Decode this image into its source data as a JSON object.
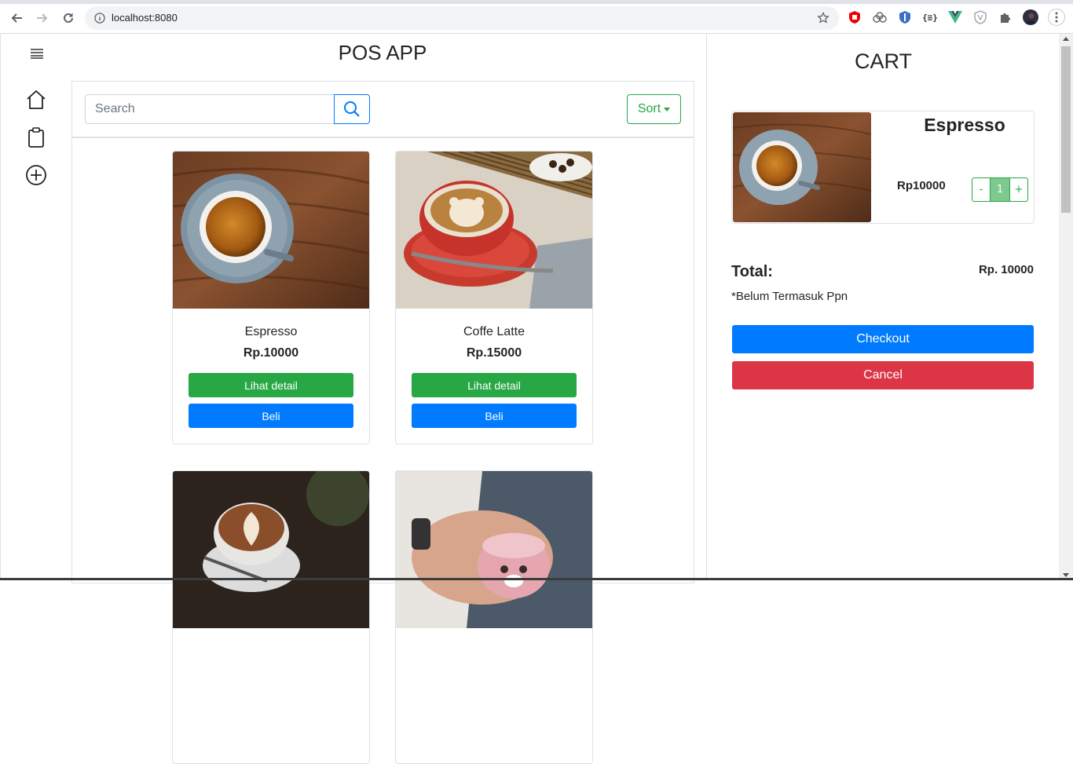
{
  "browser": {
    "url": "localhost:8080",
    "extensions": [
      "ublock-icon",
      "cloud-icon",
      "shield-icon",
      "json-icon",
      "vue-devtools-icon",
      "shield-outline-icon",
      "puzzle-icon",
      "profile-avatar",
      "menu-icon"
    ]
  },
  "sidebar": {
    "items": [
      {
        "icon": "home-icon"
      },
      {
        "icon": "clipboard-icon"
      },
      {
        "icon": "add-circle-icon"
      }
    ]
  },
  "header": {
    "title": "POS APP"
  },
  "search": {
    "placeholder": "Search"
  },
  "sort": {
    "label": "Sort"
  },
  "products": [
    {
      "name": "Espresso",
      "price": "Rp.10000",
      "detail_label": "Lihat detail",
      "buy_label": "Beli"
    },
    {
      "name": "Coffe Latte",
      "price": "Rp.15000",
      "detail_label": "Lihat detail",
      "buy_label": "Beli"
    },
    {
      "name": "",
      "price": "",
      "detail_label": "",
      "buy_label": ""
    },
    {
      "name": "",
      "price": "",
      "detail_label": "",
      "buy_label": ""
    }
  ],
  "cart": {
    "title": "CART",
    "items": [
      {
        "name": "Espresso",
        "price": "Rp10000",
        "qty": "1",
        "minus": "-",
        "plus": "+"
      }
    ],
    "total_label": "Total:",
    "total_value": "Rp. 10000",
    "note": "*Belum Termasuk Ppn",
    "checkout_label": "Checkout",
    "cancel_label": "Cancel"
  },
  "colors": {
    "primary": "#007bff",
    "success": "#28a745",
    "danger": "#dc3545"
  }
}
